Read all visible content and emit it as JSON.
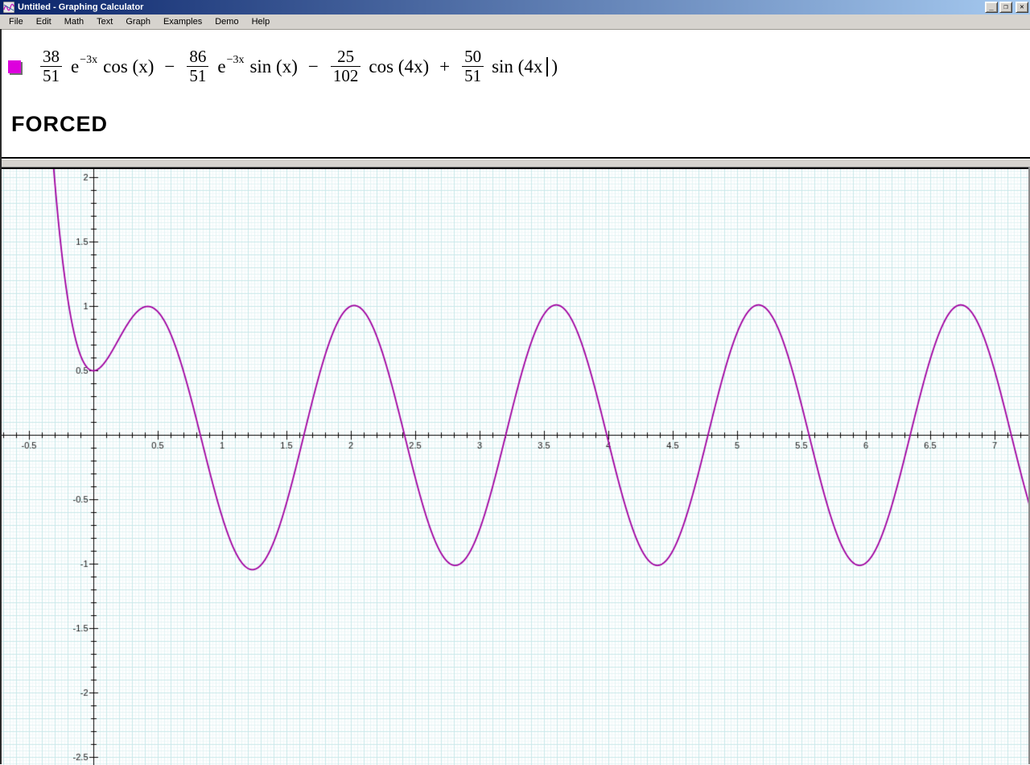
{
  "window": {
    "title": "Untitled - Graphing Calculator",
    "controls": {
      "minimize": "_",
      "restore": "❐",
      "close": "✕"
    }
  },
  "menu": {
    "items": [
      "File",
      "Edit",
      "Math",
      "Text",
      "Graph",
      "Examples",
      "Demo",
      "Help"
    ]
  },
  "equation": {
    "swatch_color": "#dd00dd",
    "tokens": [
      {
        "type": "frac",
        "num": "38",
        "den": "51"
      },
      {
        "type": "evar",
        "text": "e"
      },
      {
        "type": "sup",
        "text": "−3x"
      },
      {
        "type": "fn",
        "text": "cos (x)"
      },
      {
        "type": "op",
        "text": "−"
      },
      {
        "type": "frac",
        "num": "86",
        "den": "51"
      },
      {
        "type": "evar",
        "text": "e"
      },
      {
        "type": "sup",
        "text": "−3x"
      },
      {
        "type": "fn",
        "text": "sin (x)"
      },
      {
        "type": "op",
        "text": "−"
      },
      {
        "type": "frac",
        "num": "25",
        "den": "102"
      },
      {
        "type": "fn",
        "text": "cos (4x)"
      },
      {
        "type": "op",
        "text": "+"
      },
      {
        "type": "frac",
        "num": "50",
        "den": "51"
      },
      {
        "type": "fn",
        "text": "sin (4x"
      },
      {
        "type": "caret"
      },
      {
        "type": "fn",
        "text": ")"
      }
    ],
    "formula_plain": "38/51 e^(−3x) cos (x) − 86/51 e^(−3x) sin (x) − 25/102 cos (4x) + 50/51 sin (4x)"
  },
  "annotation": {
    "text": "FORCED"
  },
  "chart_data": {
    "type": "line",
    "title": "",
    "function": "y = (38/51)·e^(−3x)·cos(x) − (86/51)·e^(−3x)·sin(x) − (25/102)·cos(4x) + (50/51)·sin(4x)",
    "coefficients": {
      "exp_cos": 0.7450980392,
      "exp_sin": -1.6862745098,
      "cos4": -0.2450980392,
      "sin4": 0.9803921569,
      "exp_rate": -3,
      "trig_freq": 4
    },
    "xlim": [
      -0.725,
      7.275
    ],
    "ylim": [
      -2.56,
      2.065
    ],
    "x_tick_step": 0.1,
    "x_label_step": 0.5,
    "grid_minor_step": 0.025,
    "x_tick_labels": [
      "-0.5",
      "0.5",
      "1",
      "1.5",
      "2",
      "2.5",
      "3",
      "3.5",
      "4",
      "4.5",
      "5",
      "5.5",
      "6",
      "6.5",
      "7"
    ],
    "y_tick_labels": [
      "2",
      "1.5",
      "1",
      "0.5",
      "-0.5",
      "-1",
      "-1.5",
      "-2",
      "-2.5"
    ],
    "grid": true,
    "legend": "none",
    "curve_color": "#a000a0",
    "axis_color": "#000000",
    "grid_color": "#c8e8e9",
    "grid_mid_color": "#e3f3f4",
    "grid_minor_color": "#f1f9fa",
    "label_color": "#111111",
    "key_points": {
      "y_at_x0": 0.5,
      "steady_state_amplitude": 1.01,
      "first_peak": {
        "x": 0.45,
        "y": 1.0
      },
      "first_trough": {
        "x": 1.24,
        "y": -1.04
      },
      "peaks_x": [
        0.45,
        2.02,
        3.6,
        5.17,
        6.74
      ],
      "curve_enters_top_at_x": -0.31
    }
  }
}
